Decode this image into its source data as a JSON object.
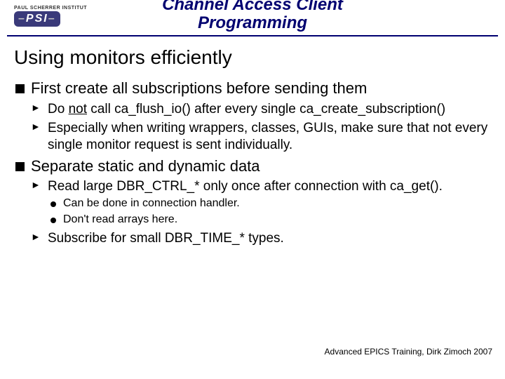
{
  "header": {
    "logo_top": "PAUL SCHERRER INSTITUT",
    "logo_text_pre": "PSI",
    "title_line1": "Channel Access Client",
    "title_line2": "Programming"
  },
  "section_title": "Using monitors efficiently",
  "bullets": {
    "b1": "First create all subscriptions before sending them",
    "b1_1a": "Do ",
    "b1_1_not": "not",
    "b1_1b": " call ca_flush_io() after every single ca_create_subscription()",
    "b1_2": "Especially when writing wrappers, classes, GUIs, make sure that not every single monitor request is sent individually.",
    "b2": "Separate static and dynamic data",
    "b2_1": "Read large DBR_CTRL_* only once after connection with ca_get().",
    "b2_1_1": "Can be done in connection handler.",
    "b2_1_2": "Don't read arrays here.",
    "b2_2": "Subscribe for small DBR_TIME_* types."
  },
  "footer": "Advanced EPICS Training, Dirk Zimoch 2007"
}
